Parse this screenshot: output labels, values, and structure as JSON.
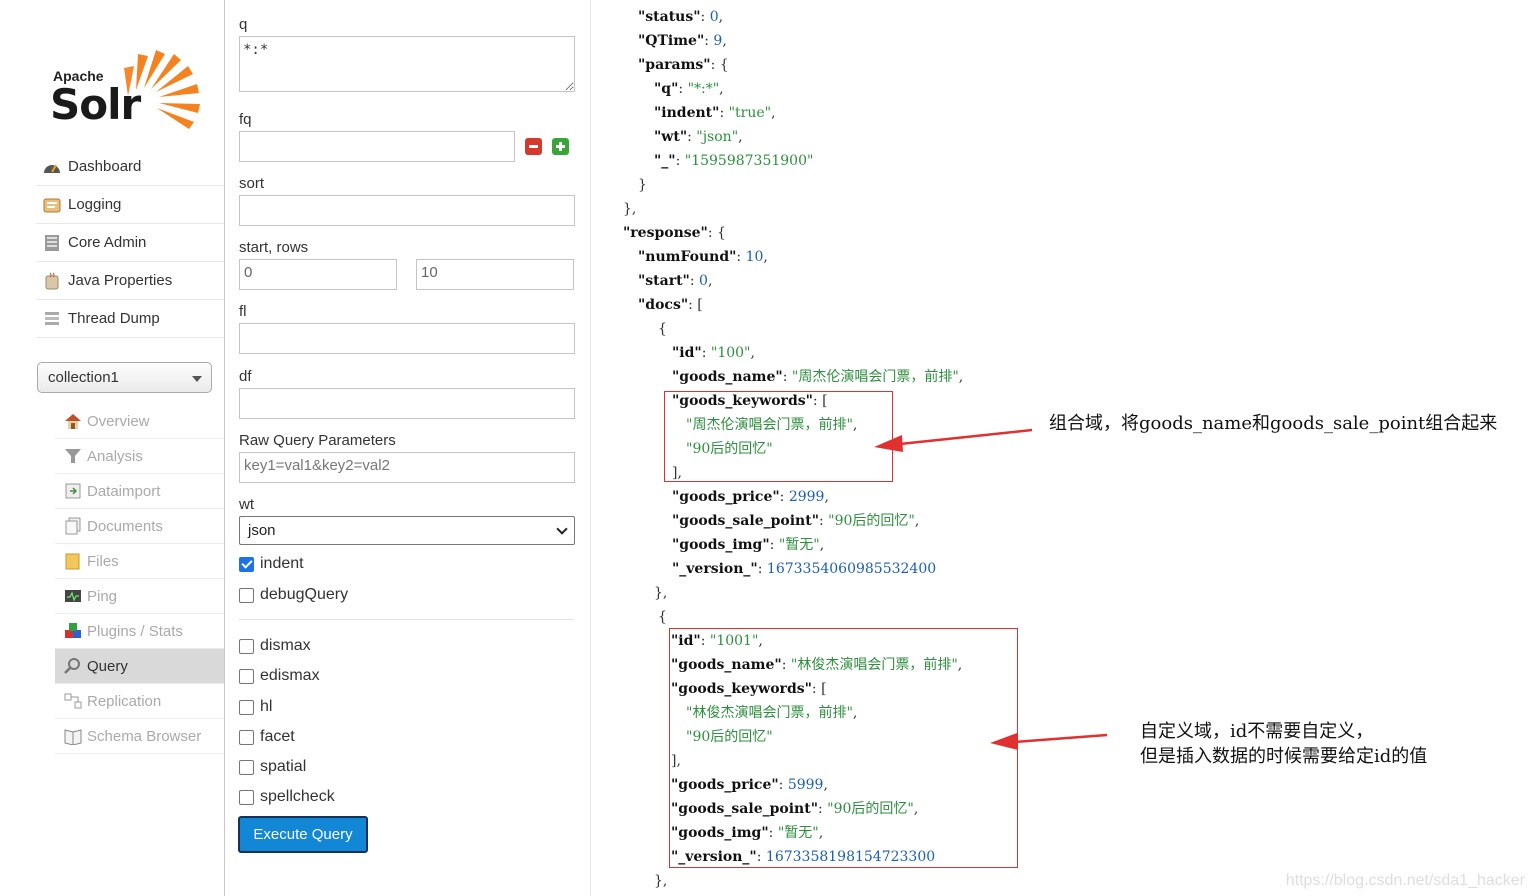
{
  "logo": {
    "apache": "Apache",
    "solr": "Solr"
  },
  "nav_main": [
    {
      "label": "Dashboard",
      "icon": "dashboard-icon"
    },
    {
      "label": "Logging",
      "icon": "logging-icon"
    },
    {
      "label": "Core Admin",
      "icon": "core-admin-icon"
    },
    {
      "label": "Java Properties",
      "icon": "java-properties-icon"
    },
    {
      "label": "Thread Dump",
      "icon": "thread-dump-icon"
    }
  ],
  "core_selector": {
    "value": "collection1"
  },
  "nav_core": [
    {
      "label": "Overview",
      "icon": "home-icon"
    },
    {
      "label": "Analysis",
      "icon": "funnel-icon"
    },
    {
      "label": "Dataimport",
      "icon": "dataimport-icon"
    },
    {
      "label": "Documents",
      "icon": "documents-icon"
    },
    {
      "label": "Files",
      "icon": "folder-icon"
    },
    {
      "label": "Ping",
      "icon": "ping-icon"
    },
    {
      "label": "Plugins / Stats",
      "icon": "plugins-icon"
    },
    {
      "label": "Query",
      "icon": "magnifier-icon",
      "active": true
    },
    {
      "label": "Replication",
      "icon": "replication-icon"
    },
    {
      "label": "Schema Browser",
      "icon": "schema-browser-icon"
    }
  ],
  "form": {
    "q_label": "q",
    "q_value": "*:*",
    "fq_label": "fq",
    "fq_value": "",
    "sort_label": "sort",
    "sort_value": "",
    "start_rows_label": "start, rows",
    "start_value": "0",
    "rows_value": "10",
    "fl_label": "fl",
    "fl_value": "",
    "df_label": "df",
    "df_value": "",
    "raw_label": "Raw Query Parameters",
    "raw_placeholder": "key1=val1&key2=val2",
    "wt_label": "wt",
    "wt_value": "json",
    "checkboxes": [
      {
        "label": "indent",
        "checked": true
      },
      {
        "label": "debugQuery",
        "checked": false
      },
      {
        "label": "dismax",
        "checked": false
      },
      {
        "label": "edismax",
        "checked": false
      },
      {
        "label": "hl",
        "checked": false
      },
      {
        "label": "facet",
        "checked": false
      },
      {
        "label": "spatial",
        "checked": false
      },
      {
        "label": "spellcheck",
        "checked": false
      }
    ],
    "execute_label": "Execute Query"
  },
  "response": {
    "status_key": "\"status\"",
    "status_val": "0",
    "qtime_key": "\"QTime\"",
    "qtime_val": "9",
    "params_key": "\"params\"",
    "q_key": "\"q\"",
    "q_val": "\"*:*\"",
    "indent_key": "\"indent\"",
    "indent_val": "\"true\"",
    "wt_key": "\"wt\"",
    "wt_val": "\"json\"",
    "underscore_key": "\"_\"",
    "underscore_val": "\"1595987351900\"",
    "response_key": "\"response\"",
    "numfound_key": "\"numFound\"",
    "numfound_val": "10",
    "start_key": "\"start\"",
    "start_val": "0",
    "docs_key": "\"docs\"",
    "docs": [
      {
        "id": "\"100\"",
        "goods_name": "\"周杰伦演唱会门票，前排\"",
        "goods_keywords": [
          "\"周杰伦演唱会门票，前排\"",
          "\"90后的回忆\""
        ],
        "goods_price": "2999",
        "goods_sale_point": "\"90后的回忆\"",
        "goods_img": "\"暂无\"",
        "version": "1673354060985532400"
      },
      {
        "id": "\"1001\"",
        "goods_name": "\"林俊杰演唱会门票，前排\"",
        "goods_keywords": [
          "\"林俊杰演唱会门票，前排\"",
          "\"90后的回忆\""
        ],
        "goods_price": "5999",
        "goods_sale_point": "\"90后的回忆\"",
        "goods_img": "\"暂无\"",
        "version": "1673358198154723300"
      }
    ],
    "field_keys": {
      "id": "\"id\"",
      "goods_name": "\"goods_name\"",
      "goods_keywords": "\"goods_keywords\"",
      "goods_price": "\"goods_price\"",
      "goods_sale_point": "\"goods_sale_point\"",
      "goods_img": "\"goods_img\"",
      "version": "\"_version_\""
    }
  },
  "annotations": {
    "note1": "组合域，将goods_name和goods_sale_point组合起来",
    "note2_line1": "自定义域，id不需要自定义，",
    "note2_line2": "但是插入数据的时候需要给定id的值"
  },
  "watermark": "https://blog.csdn.net/sda1_hacker",
  "colors": {
    "accent_button": "#1187d6",
    "json_string": "#2d8f3d",
    "json_number": "#1a5fb4",
    "annotation_red": "#e03030"
  }
}
